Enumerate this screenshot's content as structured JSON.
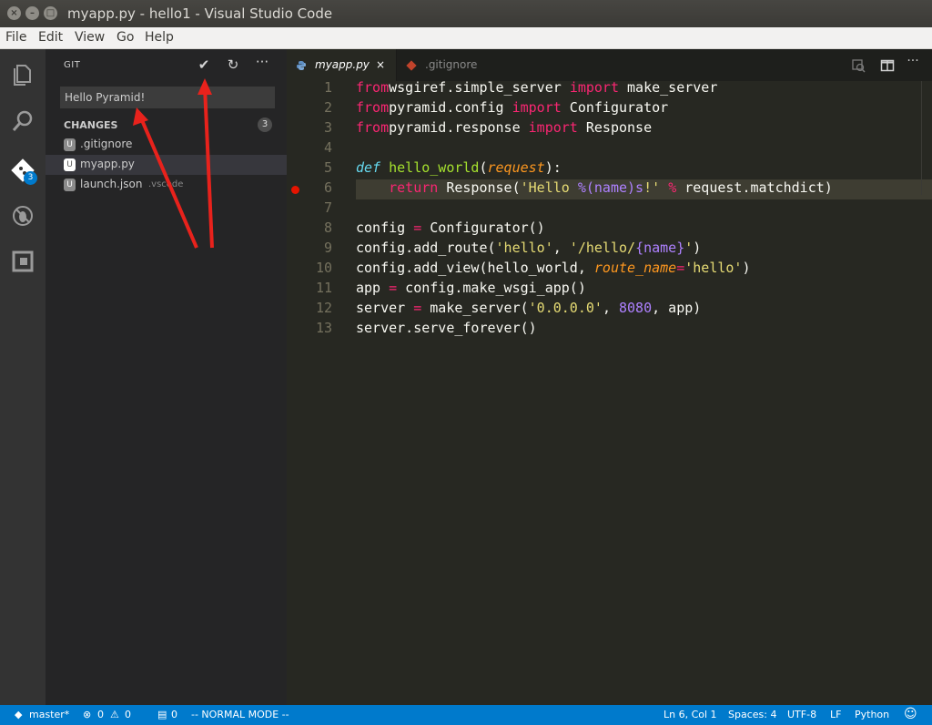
{
  "window": {
    "title": "myapp.py - hello1 - Visual Studio Code"
  },
  "menu": [
    "File",
    "Edit",
    "View",
    "Go",
    "Help"
  ],
  "activity": {
    "git_badge": "3"
  },
  "sidebar": {
    "title": "GIT",
    "commit_message": "Hello Pyramid!",
    "changes_title": "CHANGES",
    "changes_count": "3",
    "files": [
      {
        "status": "U",
        "name": ".gitignore",
        "dir": ""
      },
      {
        "status": "U",
        "name": "myapp.py",
        "dir": ""
      },
      {
        "status": "U",
        "name": "launch.json",
        "dir": ".vscode"
      }
    ]
  },
  "tabs": [
    {
      "label": "myapp.py",
      "close": "×"
    },
    {
      "label": ".gitignore"
    }
  ],
  "editor": {
    "line_numbers": [
      "1",
      "2",
      "3",
      "4",
      "5",
      "6",
      "7",
      "8",
      "9",
      "10",
      "11",
      "12",
      "13"
    ],
    "lines": [
      [
        [
          "kw",
          "from"
        ],
        [
          "",
          "wsgiref.simple_server "
        ],
        [
          "kw",
          "import"
        ],
        [
          "",
          " make_server"
        ]
      ],
      [
        [
          "kw",
          "from"
        ],
        [
          "",
          "pyramid.config "
        ],
        [
          "kw",
          "import"
        ],
        [
          "",
          " Configurator"
        ]
      ],
      [
        [
          "kw",
          "from"
        ],
        [
          "",
          "pyramid.response "
        ],
        [
          "kw",
          "import"
        ],
        [
          "",
          " Response"
        ]
      ],
      [],
      [
        [
          "def",
          "def"
        ],
        [
          "",
          " "
        ],
        [
          "fn",
          "hello_world"
        ],
        [
          "",
          "("
        ],
        [
          "arg",
          "request"
        ],
        [
          "",
          "):"
        ]
      ],
      [
        [
          "",
          "    "
        ],
        [
          "kw",
          "return"
        ],
        [
          "",
          " Response("
        ],
        [
          "str",
          "'Hello "
        ],
        [
          "num",
          "%(name)s"
        ],
        [
          "str",
          "!'"
        ],
        [
          "",
          " "
        ],
        [
          "op",
          "%"
        ],
        [
          "",
          " request.matchdict)"
        ]
      ],
      [],
      [
        [
          "",
          "config "
        ],
        [
          "op",
          "="
        ],
        [
          "",
          " Configurator()"
        ]
      ],
      [
        [
          "",
          "config.add_route("
        ],
        [
          "str",
          "'hello'"
        ],
        [
          "",
          ", "
        ],
        [
          "str",
          "'/hello/"
        ],
        [
          "num",
          "{name}"
        ],
        [
          "str",
          "'"
        ],
        [
          "",
          ")"
        ]
      ],
      [
        [
          "",
          "config.add_view(hello_world, "
        ],
        [
          "arg",
          "route_name"
        ],
        [
          "op",
          "="
        ],
        [
          "str",
          "'hello'"
        ],
        [
          "",
          ")"
        ]
      ],
      [
        [
          "",
          "app "
        ],
        [
          "op",
          "="
        ],
        [
          "",
          " config.make_wsgi_app()"
        ]
      ],
      [
        [
          "",
          "server "
        ],
        [
          "op",
          "="
        ],
        [
          "",
          " make_server("
        ],
        [
          "str",
          "'0.0.0.0'"
        ],
        [
          "",
          ", "
        ],
        [
          "num",
          "8080"
        ],
        [
          "",
          ", app)"
        ]
      ],
      [
        [
          "",
          "server.serve_forever()"
        ]
      ]
    ]
  },
  "status": {
    "branch": "master*",
    "errors": "0",
    "warnings": "0",
    "info": "0",
    "vim_mode": "-- NORMAL MODE --",
    "position": "Ln 6, Col 1",
    "spaces": "Spaces: 4",
    "encoding": "UTF-8",
    "eol": "LF",
    "language": "Python"
  },
  "colors": {
    "accent": "#007acc",
    "breakpoint": "#e51400",
    "arrow": "#e8221c"
  },
  "icons": [
    "explorer-icon",
    "search-icon",
    "git-icon",
    "debug-icon",
    "extensions-icon",
    "check-icon",
    "refresh-icon",
    "more-icon",
    "python-file-icon",
    "gitignore-file-icon",
    "compare-icon",
    "split-editor-icon",
    "smiley-icon"
  ]
}
